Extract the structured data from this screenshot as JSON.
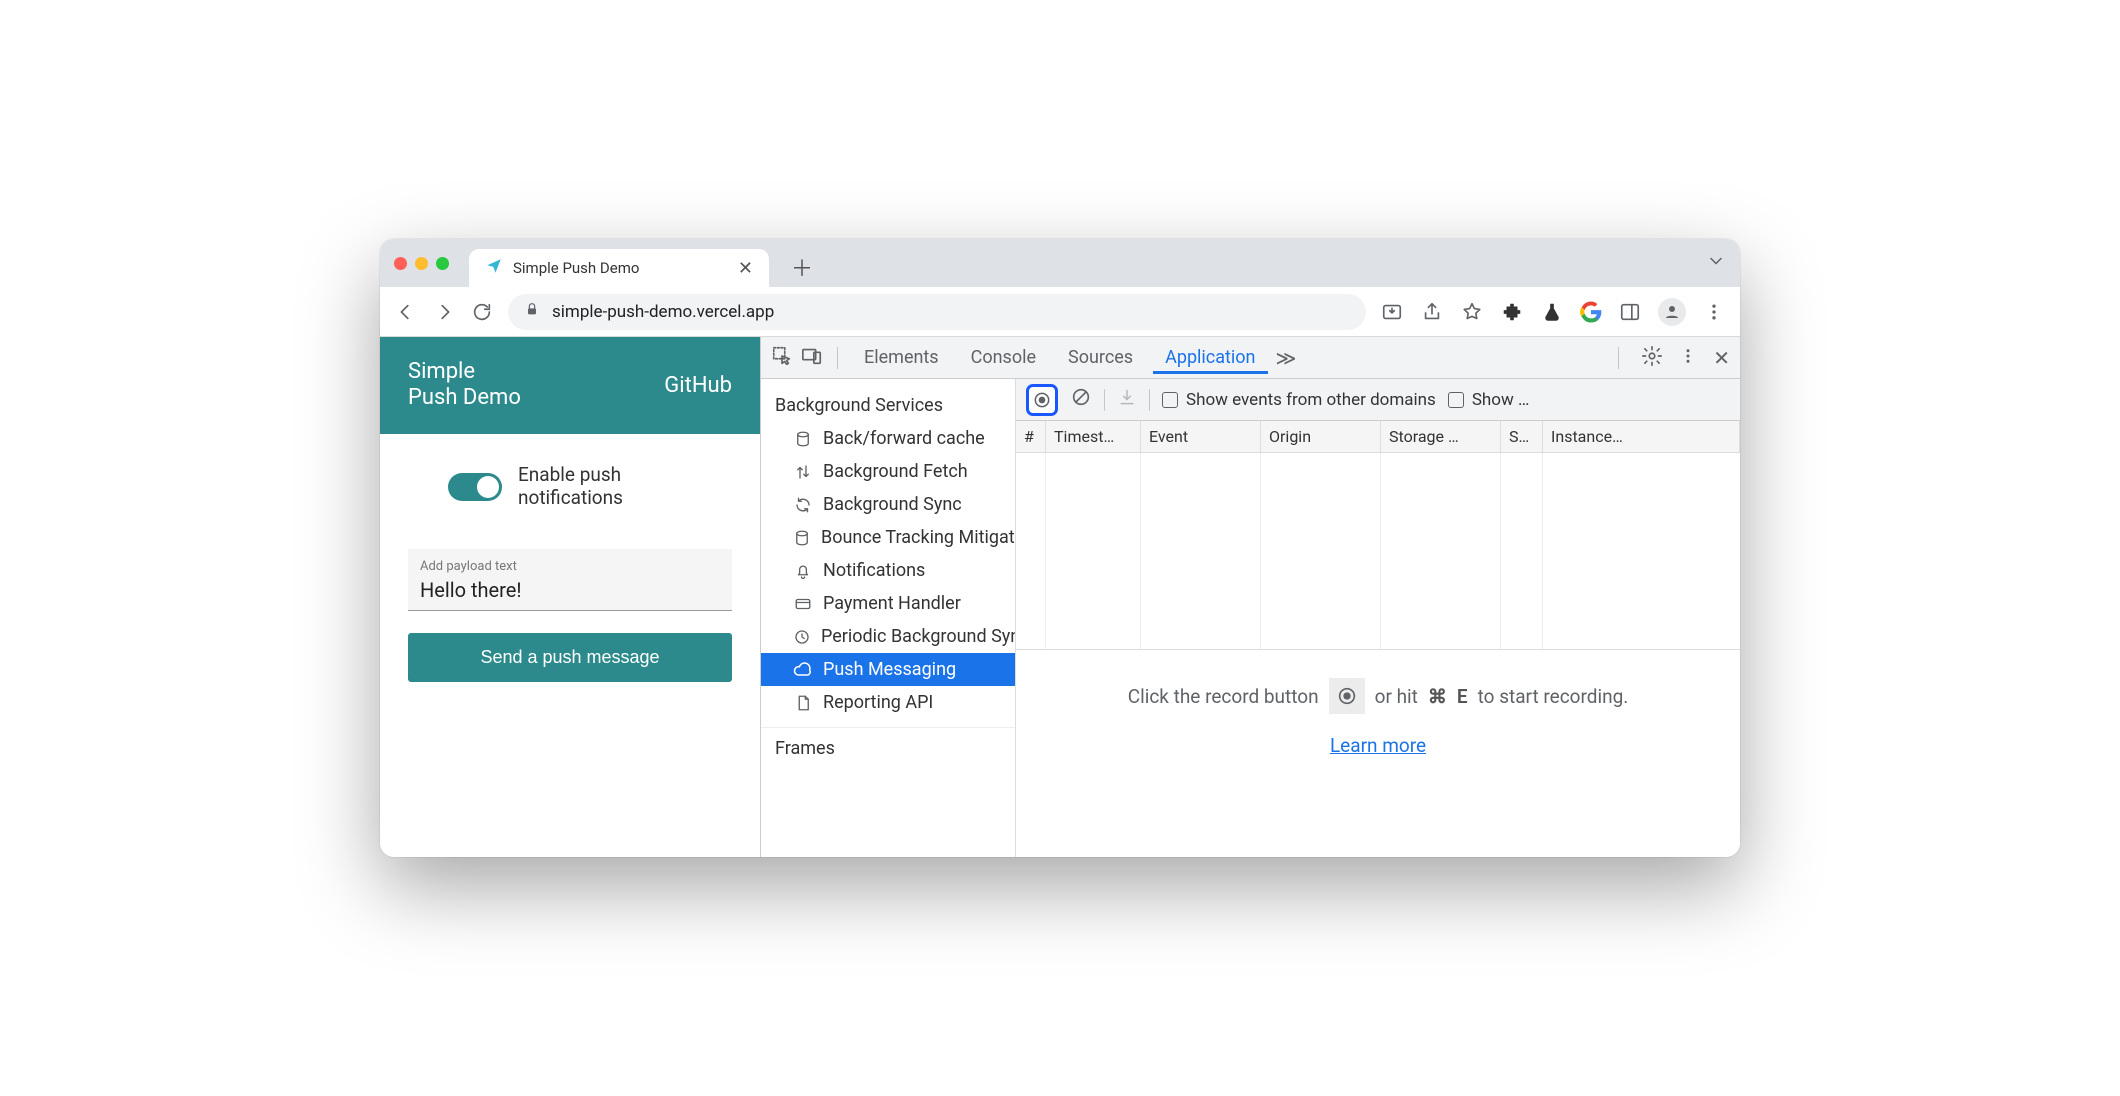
{
  "browser": {
    "tab_title": "Simple Push Demo",
    "url": "simple-push-demo.vercel.app"
  },
  "page": {
    "app_title_line1": "Simple",
    "app_title_line2": "Push Demo",
    "github_link": "GitHub",
    "toggle_label_line1": "Enable push",
    "toggle_label_line2": "notifications",
    "payload_label": "Add payload text",
    "payload_value": "Hello there!",
    "send_button": "Send a push message"
  },
  "devtools": {
    "tabs": {
      "elements": "Elements",
      "console": "Console",
      "sources": "Sources",
      "application": "Application"
    },
    "sidebar": {
      "section": "Background Services",
      "items": [
        "Back/forward cache",
        "Background Fetch",
        "Background Sync",
        "Bounce Tracking Mitigations",
        "Notifications",
        "Payment Handler",
        "Periodic Background Sync",
        "Push Messaging",
        "Reporting API"
      ],
      "frames": "Frames"
    },
    "toolbar": {
      "showOtherDomains": "Show events from other domains",
      "showTruncated": "Show …"
    },
    "columns": {
      "n": "#",
      "timestamp": "Timest…",
      "event": "Event",
      "origin": "Origin",
      "storage": "Storage …",
      "sw": "S…",
      "instance": "Instance…"
    },
    "hint": {
      "pre": "Click the record button",
      "mid": "or hit",
      "shortcut_sym": "⌘",
      "shortcut_key": "E",
      "post": "to start recording.",
      "learn": "Learn more"
    }
  }
}
